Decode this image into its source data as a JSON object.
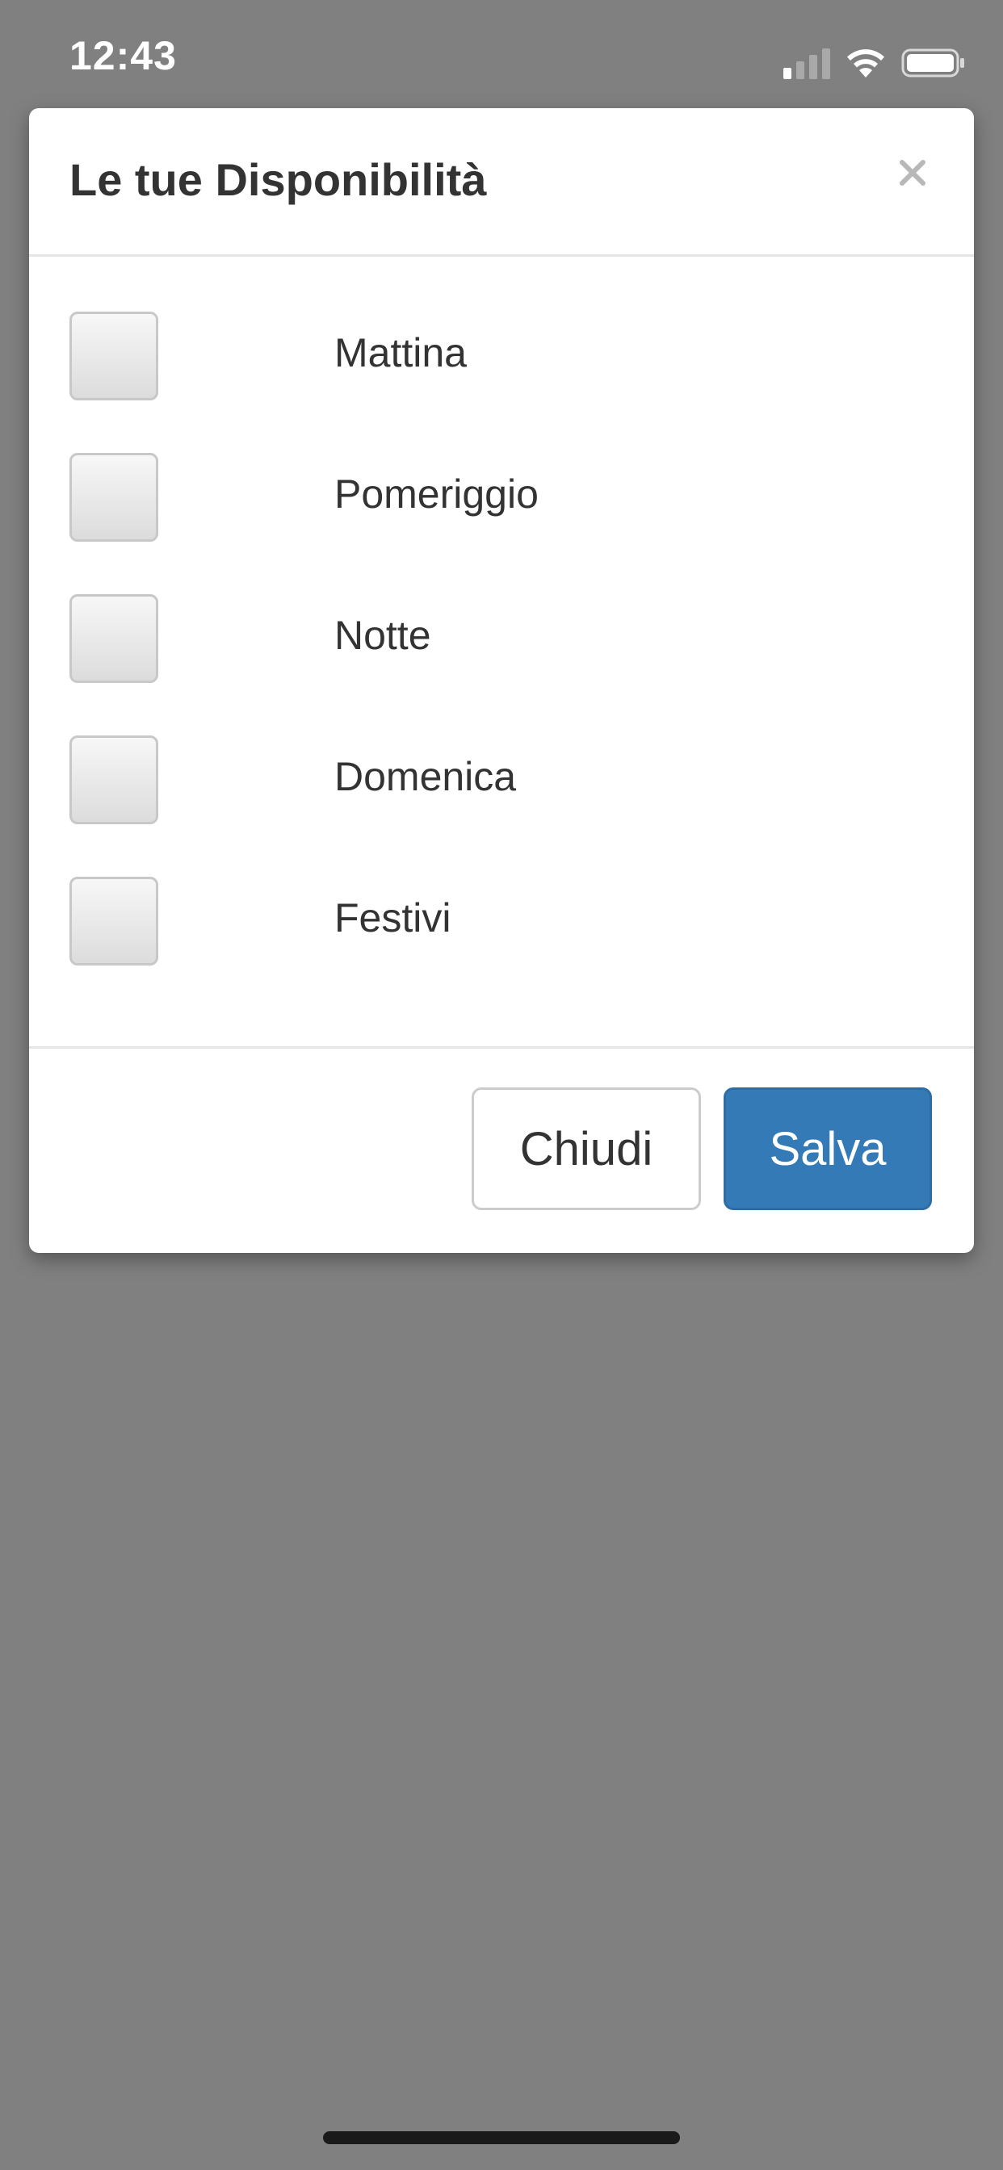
{
  "status_bar": {
    "time": "12:43",
    "icons": [
      "cellular-signal-icon",
      "wifi-icon",
      "battery-icon"
    ]
  },
  "modal": {
    "title": "Le tue Disponibilità",
    "close_symbol": "×",
    "options": [
      {
        "label": "Mattina",
        "checked": false
      },
      {
        "label": "Pomeriggio",
        "checked": false
      },
      {
        "label": "Notte",
        "checked": false
      },
      {
        "label": "Domenica",
        "checked": false
      },
      {
        "label": "Festivi",
        "checked": false
      }
    ],
    "footer": {
      "close_label": "Chiudi",
      "save_label": "Salva"
    }
  },
  "colors": {
    "overlay": "#808080",
    "primary": "#337ab7",
    "text": "#333333"
  }
}
